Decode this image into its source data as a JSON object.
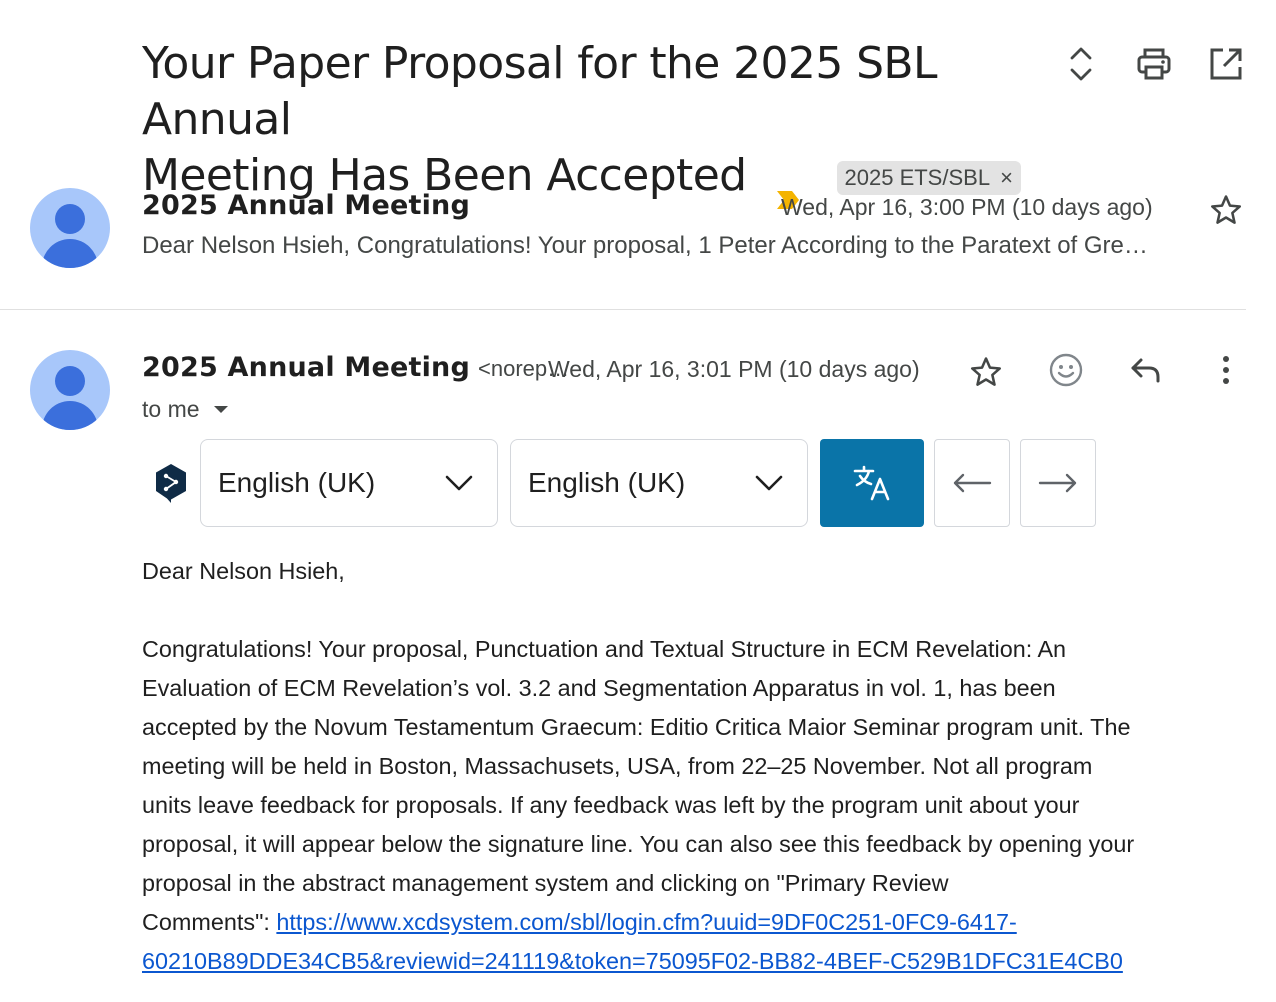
{
  "subject": {
    "line1": "Your Paper Proposal for the 2025 SBL Annual",
    "line2": "Meeting Has Been Accepted",
    "label": "2025 ETS/SBL",
    "label_close": "×"
  },
  "toolbar": {
    "icons": [
      "expand-collapse-icon",
      "print-icon",
      "open-in-new-window-icon"
    ]
  },
  "collapsed_message": {
    "sender": "2025 Annual Meeting",
    "date": "Wed, Apr 16, 3:00 PM (10 days ago)",
    "snippet": "Dear Nelson Hsieh, Congratulations! Your proposal, 1 Peter According to the Paratext of Gre…"
  },
  "open_message": {
    "sender": "2025 Annual Meeting",
    "email": "<norep…",
    "date": "Wed, Apr 16, 3:01 PM (10 days ago)",
    "recipient": "to me"
  },
  "translation": {
    "source_language": "English (UK)",
    "target_language": "English (UK)",
    "brand_color": "#0a74a8"
  },
  "body": {
    "greeting": "Dear Nelson Hsieh,",
    "paragraph_lines": [
      "Congratulations! Your proposal, Punctuation and Textual Structure in ECM Revelation: An",
      "Evaluation of ECM Revelation’s vol. 3.2 and Segmentation Apparatus in vol. 1, has been",
      "accepted by the Novum Testamentum Graecum: Editio Critica Maior Seminar program unit. The",
      "meeting will be held in Boston, Massachusets, USA, from 22–25 November. Not all program",
      "units leave feedback for proposals. If any feedback was left by the program unit about your",
      "proposal, it will appear below the signature line. You can also see this feedback by opening your",
      "proposal in the abstract management system and clicking on \"Primary Review"
    ],
    "link_prefix": "Comments\": ",
    "link_line1": "https://www.xcdsystem.com/sbl/login.cfm?uuid=9DF0C251-0FC9-6417-",
    "link_line2": "60210B89DDE34CB5&reviewid=241119&token=75095F02-BB82-4BEF-C529B1DFC31E4CB0"
  }
}
